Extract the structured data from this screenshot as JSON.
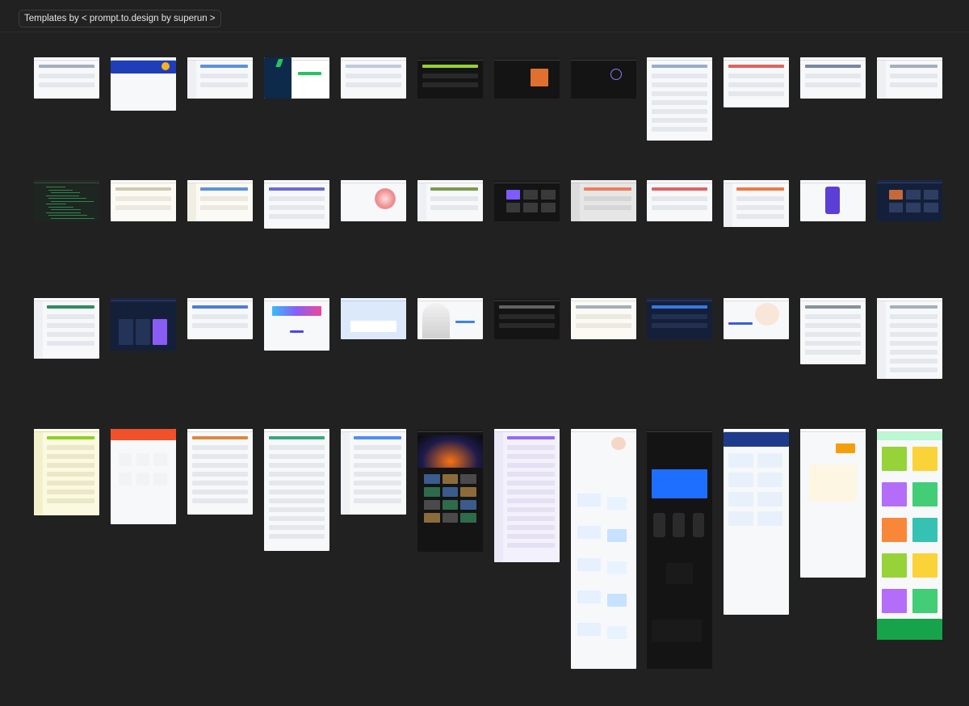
{
  "header": {
    "title": "Templates by < prompt.to.design by superun >"
  },
  "colors": {
    "background": "#212121",
    "header_border": "#2c2c2c",
    "pill_border": "#3d3d3d",
    "pill_text": "#e6e6e6"
  },
  "templates": [
    {
      "theme": "light",
      "accent": "#9aa7b5",
      "style": "table"
    },
    {
      "theme": "light",
      "accent": "#1f3fb8",
      "style": "hero"
    },
    {
      "theme": "light",
      "accent": "#4a86d8",
      "style": "sidebar"
    },
    {
      "theme": "split",
      "accent": "#22c55e",
      "style": "split-dark"
    },
    {
      "theme": "light",
      "accent": "#b8c4d6",
      "style": "chart"
    },
    {
      "theme": "dark",
      "accent": "#a3e635",
      "style": "panels"
    },
    {
      "theme": "dark",
      "accent": "#e07030",
      "style": "video"
    },
    {
      "theme": "dark",
      "accent": "#8b7cf6",
      "style": "orb"
    },
    {
      "theme": "light",
      "accent": "#8fa3c4",
      "style": "doc"
    },
    {
      "theme": "light",
      "accent": "#d9534f",
      "style": "list"
    },
    {
      "theme": "light",
      "accent": "#6a7b94",
      "style": "list"
    },
    {
      "theme": "light",
      "accent": "#9aa7b5",
      "style": "sidebar"
    },
    {
      "theme": "dark-green",
      "accent": "#4ade80",
      "style": "code"
    },
    {
      "theme": "cream",
      "accent": "#c9c3a8",
      "style": "blank"
    },
    {
      "theme": "cream",
      "accent": "#4a86d8",
      "style": "sidebar"
    },
    {
      "theme": "light",
      "accent": "#5b5bd6",
      "style": "form"
    },
    {
      "theme": "light",
      "accent": "#f08a8a",
      "style": "gradient"
    },
    {
      "theme": "light",
      "accent": "#6c8f3c",
      "style": "feed"
    },
    {
      "theme": "dark",
      "accent": "#7c5cff",
      "style": "media"
    },
    {
      "theme": "gray",
      "accent": "#f07050",
      "style": "card"
    },
    {
      "theme": "light",
      "accent": "#e05050",
      "style": "grid"
    },
    {
      "theme": "light",
      "accent": "#f06a30",
      "style": "calendar"
    },
    {
      "theme": "light",
      "accent": "#5b3fd6",
      "style": "phone"
    },
    {
      "theme": "navy",
      "accent": "#c46a3a",
      "style": "media"
    },
    {
      "theme": "light",
      "accent": "#1a7f4f",
      "style": "store"
    },
    {
      "theme": "navy",
      "accent": "#8a5cf6",
      "style": "pricing"
    },
    {
      "theme": "light",
      "accent": "#3a6fd6",
      "style": "doc"
    },
    {
      "theme": "light",
      "accent": "#4f46e5",
      "style": "banner"
    },
    {
      "theme": "sky",
      "accent": "#6aa8f0",
      "style": "sky"
    },
    {
      "theme": "light",
      "accent": "#bfbfbf",
      "style": "arch"
    },
    {
      "theme": "dark",
      "accent": "#6b6b6b",
      "style": "panels"
    },
    {
      "theme": "cream",
      "accent": "#9aa7b5",
      "style": "blank"
    },
    {
      "theme": "navy",
      "accent": "#3b82f6",
      "style": "blank"
    },
    {
      "theme": "light",
      "accent": "#3b5bdb",
      "style": "illustration"
    },
    {
      "theme": "light",
      "accent": "#7a8596",
      "style": "form"
    },
    {
      "theme": "light",
      "accent": "#9aa7b5",
      "style": "tree"
    },
    {
      "theme": "yellow",
      "accent": "#84cc16",
      "style": "social"
    },
    {
      "theme": "light",
      "accent": "#f0502a",
      "style": "orange"
    },
    {
      "theme": "light",
      "accent": "#d97b2a",
      "style": "shop"
    },
    {
      "theme": "light",
      "accent": "#22a06b",
      "style": "pricing-light"
    },
    {
      "theme": "light",
      "accent": "#3b82f6",
      "style": "sheet"
    },
    {
      "theme": "dark",
      "accent": "#f97316",
      "style": "gallery"
    },
    {
      "theme": "lavender",
      "accent": "#8b5cf6",
      "style": "social"
    },
    {
      "theme": "light",
      "accent": "#2563eb",
      "style": "landing"
    },
    {
      "theme": "dark",
      "accent": "#1e6fff",
      "style": "landing-dark"
    },
    {
      "theme": "light",
      "accent": "#1e3a8a",
      "style": "course"
    },
    {
      "theme": "light",
      "accent": "#f59e0b",
      "style": "newsletter"
    },
    {
      "theme": "light",
      "accent": "#16a34a",
      "style": "resource"
    }
  ]
}
